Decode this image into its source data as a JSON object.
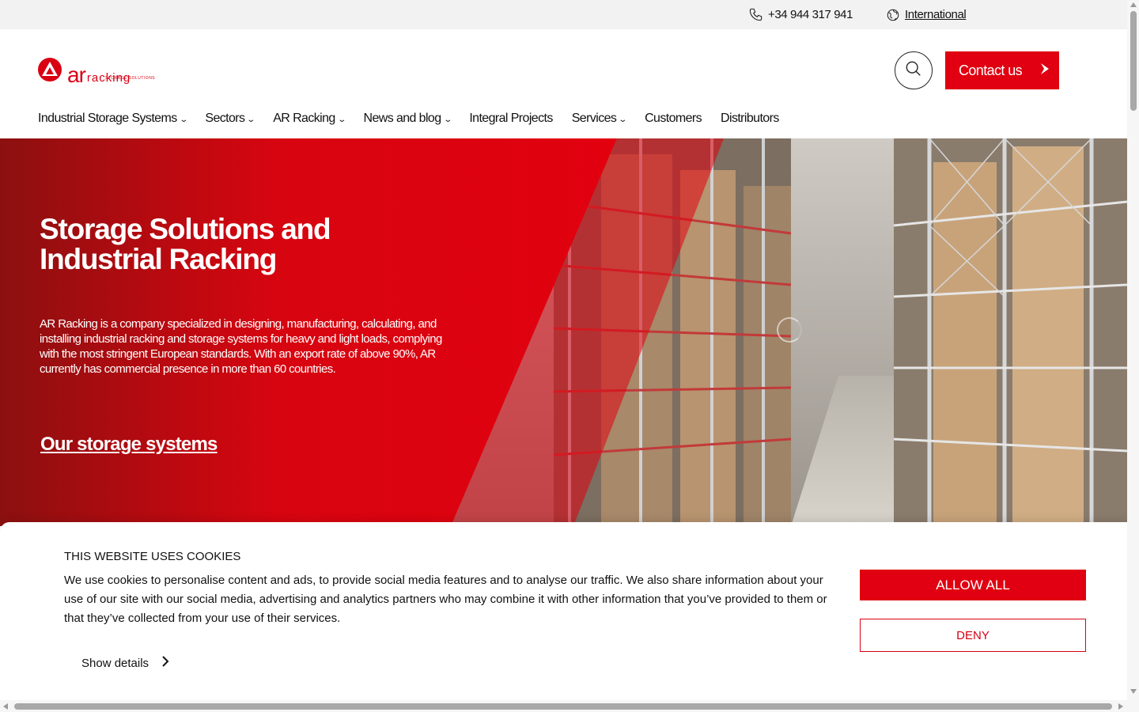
{
  "topbar": {
    "phone": "+34 944 317 941",
    "phone_icon": "phone-icon",
    "international": "International",
    "international_icon": "globe-icon"
  },
  "header": {
    "logo_text": "ar",
    "logo_racking": "racking",
    "logo_sub": "STORAGE SOLUTIONS",
    "search_icon": "search-icon",
    "contact_label": "Contact us",
    "contact_icon": "chevron-right-icon",
    "accent_color": "#e00011"
  },
  "nav": {
    "items": [
      {
        "label": "Industrial Storage Systems",
        "has_dropdown": true
      },
      {
        "label": "Sectors",
        "has_dropdown": true
      },
      {
        "label": "AR Racking",
        "has_dropdown": true
      },
      {
        "label": "News and blog",
        "has_dropdown": true
      },
      {
        "label": "Integral Projects",
        "has_dropdown": false
      },
      {
        "label": "Services",
        "has_dropdown": true
      },
      {
        "label": "Customers",
        "has_dropdown": false
      },
      {
        "label": "Distributors",
        "has_dropdown": false
      }
    ],
    "chevron": "⌄"
  },
  "hero": {
    "title_line1": "Storage Solutions and",
    "title_line2": "Industrial Racking",
    "text": "AR Racking is a company specialized in designing, manufacturing, calculating, and installing industrial racking and storage systems for heavy and light loads, complying with the most stringent European standards. With an export rate of above 90%, AR currently has commercial presence in more than 60 countries.",
    "link": "Our storage systems"
  },
  "cookie": {
    "title": "THIS WEBSITE USES COOKIES",
    "body": "We use cookies to personalise content and ads, to provide social media features and to analyse our traffic. We also share information about your use of our site with our social media, advertising and analytics partners who may combine it with other information that you’ve provided to them or that they’ve collected from your use of their services.",
    "show_details": "Show details",
    "allow_all": "ALLOW ALL",
    "deny": "DENY"
  }
}
